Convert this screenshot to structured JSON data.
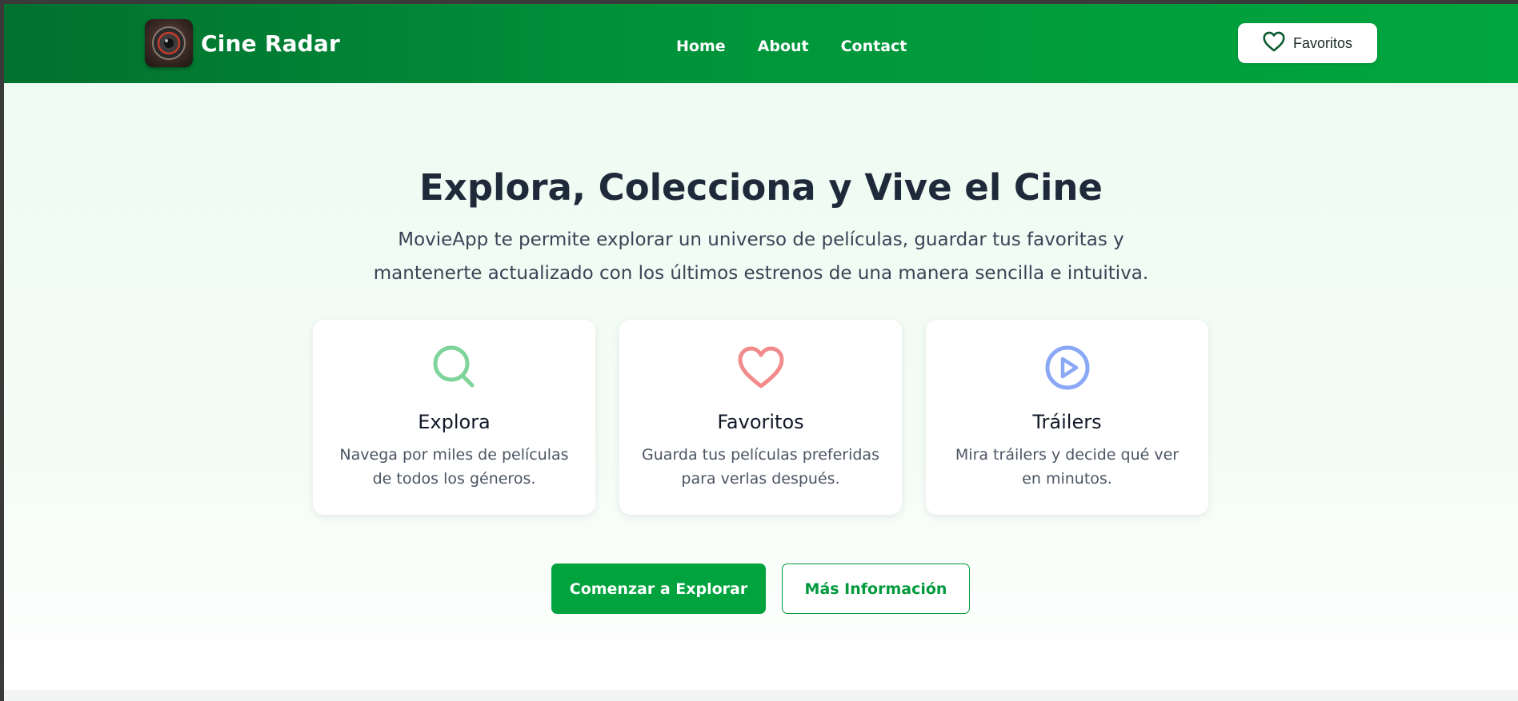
{
  "header": {
    "brand_name": "Cine Radar",
    "logo_icon": "camera-lens-icon",
    "nav": [
      {
        "label": "Home"
      },
      {
        "label": "About"
      },
      {
        "label": "Contact"
      }
    ],
    "favorites_button": {
      "label": "Favoritos",
      "icon": "heart-outline-icon"
    }
  },
  "hero": {
    "title": "Explora, Colecciona y Vive el Cine",
    "subtitle_line1": "MovieApp te permite explorar un universo de películas, guardar tus favoritas y",
    "subtitle_line2": "mantenerte actualizado con los últimos estrenos de una manera sencilla e intuitiva."
  },
  "features": [
    {
      "icon": "search-icon",
      "icon_color": "#7fd49a",
      "title": "Explora",
      "description": "Navega por miles de películas de todos los géneros."
    },
    {
      "icon": "heart-icon",
      "icon_color": "#f28b8b",
      "title": "Favoritos",
      "description": "Guarda tus películas preferidas para verlas después."
    },
    {
      "icon": "play-circle-icon",
      "icon_color": "#8aa8f5",
      "title": "Tráilers",
      "description": "Mira tráilers y decide qué ver en minutos."
    }
  ],
  "actions": {
    "primary_label": "Comenzar a Explorar",
    "secondary_label": "Más Información"
  },
  "colors": {
    "brand_green": "#00943a",
    "primary_button": "#01a33e",
    "title_text": "#1e2a3a"
  }
}
